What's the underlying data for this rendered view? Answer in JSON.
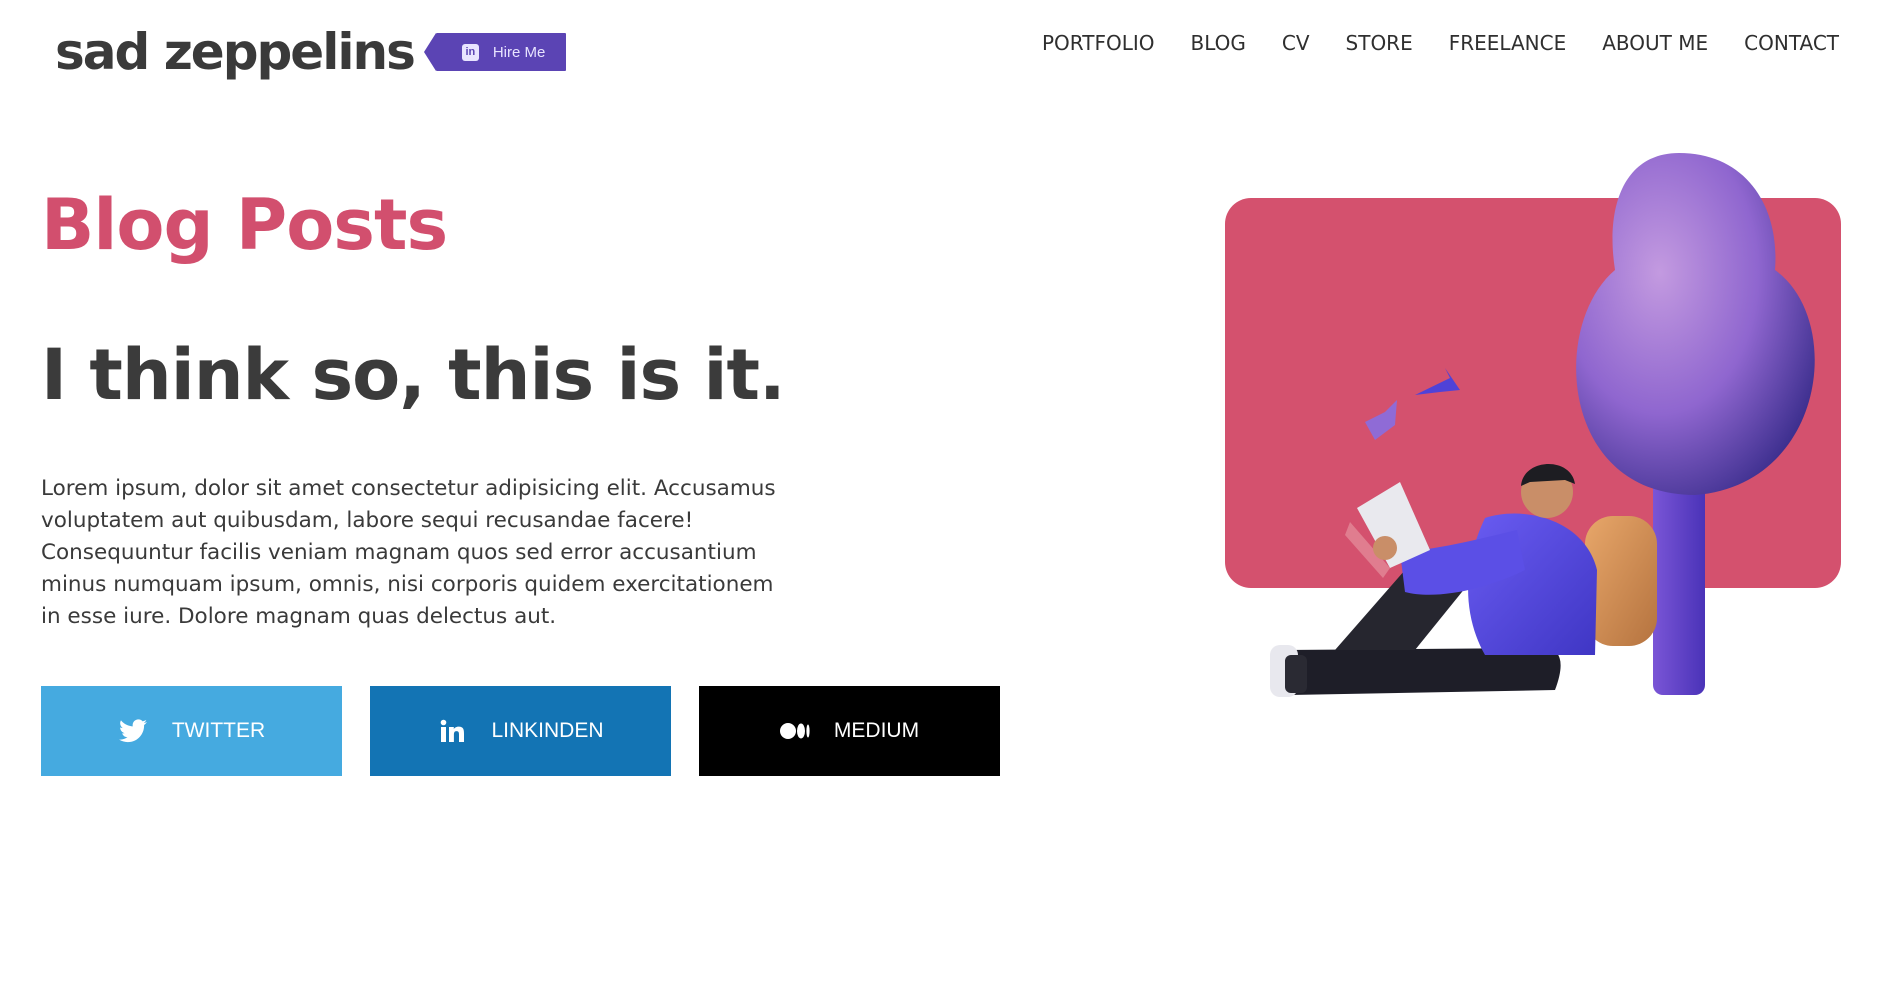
{
  "header": {
    "logo_text": "sad zeppelins",
    "hire_badge_label": "Hire Me",
    "hire_badge_icon": "linkedin-icon"
  },
  "nav": {
    "items": [
      "PORTFOLIO",
      "BLOG",
      "CV",
      "STORE",
      "FREELANCE",
      "ABOUT ME",
      "CONTACT"
    ]
  },
  "hero": {
    "section_title": "Blog Posts",
    "headline": "I think so, this is it.",
    "body": "Lorem ipsum, dolor sit amet consectetur adipisicing elit. Accusamus voluptatem aut quibusdam, labore sequi recusandae facere! Consequuntur facilis veniam magnam quos sed error accusantium minus numquam ipsum, omnis, nisi corporis quidem exercitationem in esse iure. Dolore magnam quas delectus aut."
  },
  "social": [
    {
      "label": "TWITTER",
      "icon": "twitter-icon",
      "color": "#45aae0"
    },
    {
      "label": "LINKINDEN",
      "icon": "linkedin-icon",
      "color": "#1374b4"
    },
    {
      "label": "MEDIUM",
      "icon": "medium-icon",
      "color": "#000000"
    }
  ],
  "colors": {
    "accent": "#d24f6e",
    "badge": "#5b44b4",
    "text": "#3b3b3b"
  }
}
